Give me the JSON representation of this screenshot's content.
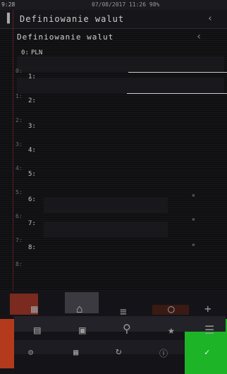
{
  "status_bar": {
    "left": "9:28",
    "center": "07/08/2017 11:26 98%"
  },
  "titlebar": {
    "title": "Definiowanie walut",
    "back_icon": "back-arrow-icon"
  },
  "subtitle": {
    "text": "Definiowanie walut",
    "back_icon": "chevron-left-icon"
  },
  "rows": [
    {
      "num": "0:",
      "code": "PLN"
    },
    {
      "num": "1:",
      "code": ""
    },
    {
      "num": "2:",
      "code": ""
    },
    {
      "num": "3:",
      "code": ""
    },
    {
      "num": "4:",
      "code": ""
    },
    {
      "num": "5:",
      "code": ""
    },
    {
      "num": "6:",
      "code": ""
    },
    {
      "num": "7:",
      "code": ""
    },
    {
      "num": "8:",
      "code": ""
    }
  ],
  "ghost_row_labels": [
    "0:",
    "1:",
    "2:",
    "3:",
    "4:",
    "5:",
    "6:",
    "7:",
    "8:"
  ],
  "colors": {
    "red_tile": "#c0392b",
    "green_tile": "#1fd12a",
    "accent_line": "#7a1f1f"
  },
  "nav_icons": [
    "grid-icon",
    "home-icon",
    "search-icon",
    "star-icon",
    "menu-icon"
  ]
}
